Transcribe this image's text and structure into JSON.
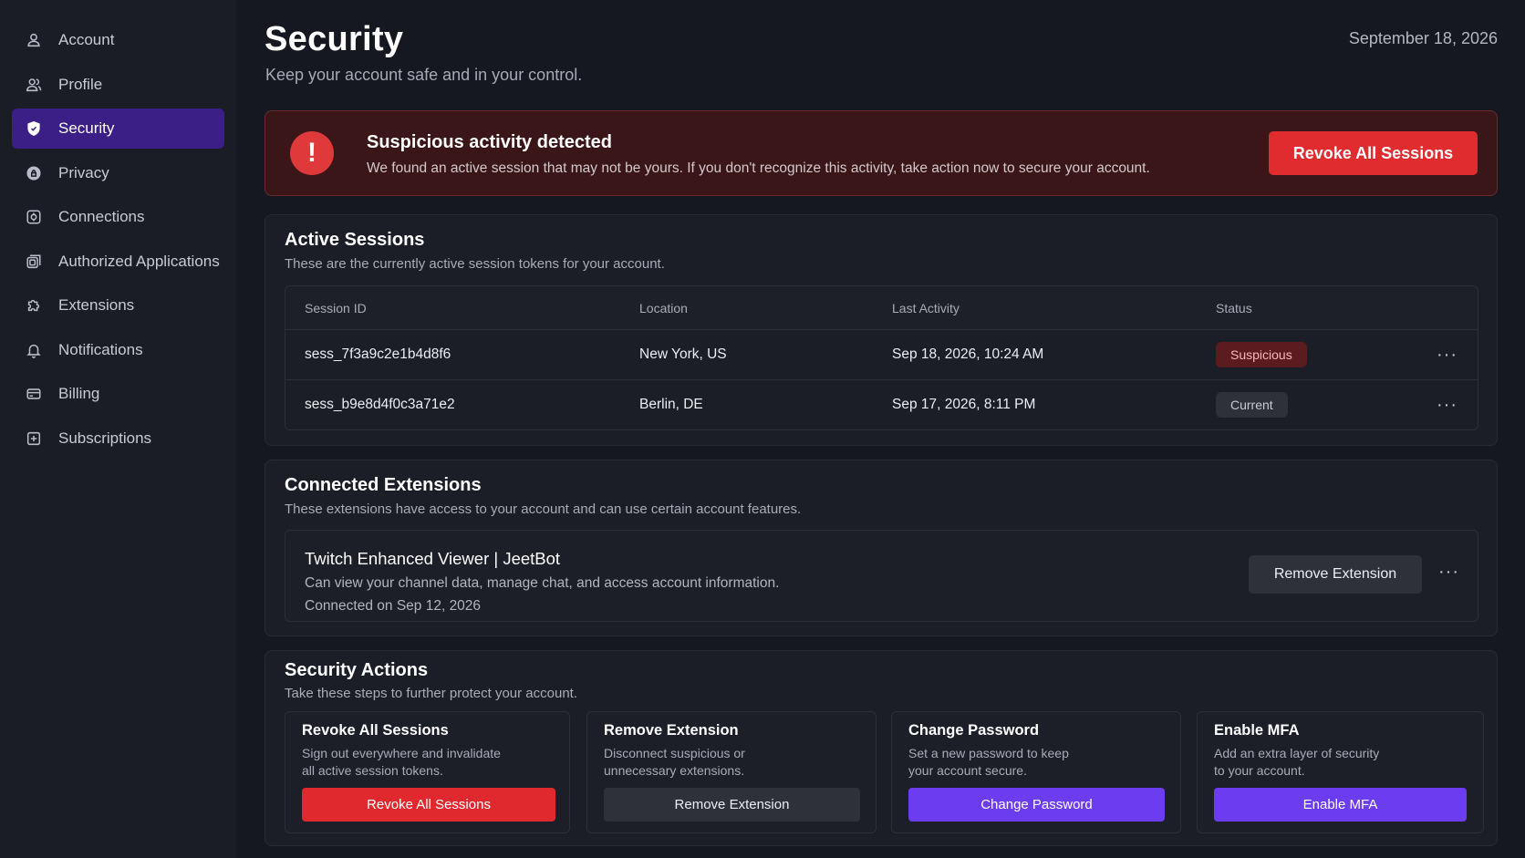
{
  "sidebar": {
    "items": [
      {
        "label": "Account",
        "icon": "user-icon"
      },
      {
        "label": "Profile",
        "icon": "users-icon"
      },
      {
        "label": "Security",
        "icon": "shield-icon",
        "active": true
      },
      {
        "label": "Privacy",
        "icon": "privacy-icon"
      },
      {
        "label": "Connections",
        "icon": "connections-icon"
      },
      {
        "label": "Authorized Applications",
        "icon": "apps-icon"
      },
      {
        "label": "Extensions",
        "icon": "puzzle-icon"
      },
      {
        "label": "Notifications",
        "icon": "bell-icon"
      },
      {
        "label": "Billing",
        "icon": "card-icon"
      },
      {
        "label": "Subscriptions",
        "icon": "subscription-icon"
      }
    ]
  },
  "header": {
    "title": "Security",
    "subtitle": "Keep your account safe and in your control.",
    "date": "September 18, 2026"
  },
  "alert": {
    "title": "Suspicious activity detected",
    "text": "We found an active session that may not be yours. If you don't recognize this activity, take action now to secure your account.",
    "button": "Revoke All Sessions",
    "icon": "alert-icon"
  },
  "sessions": {
    "title": "Active Sessions",
    "subtitle": "These are the currently active session tokens for your account.",
    "columns": [
      "Session ID",
      "Location",
      "Last Activity",
      "Status"
    ],
    "rows": [
      {
        "id": "sess_7f3a9c2e1b4d8f6",
        "location": "New York, US",
        "last_activity": "Sep 18, 2026, 10:24 AM",
        "status": "Suspicious"
      },
      {
        "id": "sess_b9e8d4f0c3a71e2",
        "location": "Berlin, DE",
        "last_activity": "Sep 17, 2026, 8:11 PM",
        "status": "Current"
      }
    ],
    "more_label": "···"
  },
  "extensions": {
    "title": "Connected Extensions",
    "subtitle": "These extensions have access to your account and can use certain account features.",
    "item": {
      "name": "Twitch Enhanced Viewer | JeetBot",
      "description": "Can view your channel data, manage chat, and access account information.",
      "connected": "Connected on Sep 12, 2026",
      "button": "Remove Extension"
    }
  },
  "actions": {
    "title": "Security Actions",
    "subtitle": "Take these steps to further protect your account.",
    "cards": [
      {
        "title": "Revoke All Sessions",
        "line1": "Sign out everywhere and invalidate",
        "line2": "all active session tokens.",
        "button": "Revoke All Sessions"
      },
      {
        "title": "Remove Extension",
        "line1": "Disconnect suspicious or",
        "line2": "unnecessary extensions.",
        "button": "Remove Extension"
      },
      {
        "title": "Change Password",
        "line1": "Set a new password to keep",
        "line2": "your account secure.",
        "button": "Change Password"
      },
      {
        "title": "Enable MFA",
        "line1": "Add an extra layer of security",
        "line2": "to your account.",
        "button": "Enable MFA"
      }
    ]
  },
  "colors": {
    "accent_purple": "#6c3cf0",
    "danger_red": "#e0292e",
    "active_nav": "#3b1f86"
  }
}
